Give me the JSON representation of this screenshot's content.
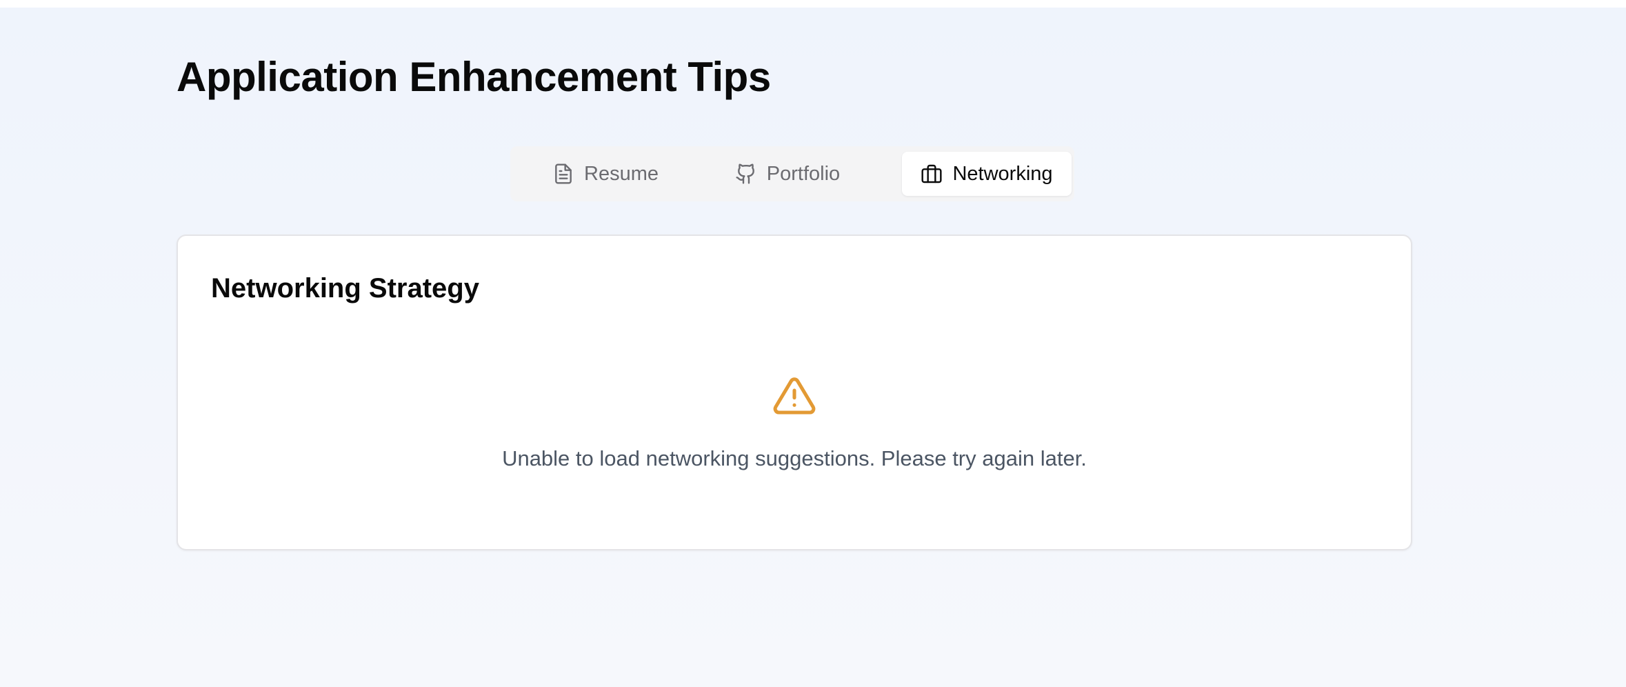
{
  "page": {
    "title": "Application Enhancement Tips"
  },
  "tabs": [
    {
      "label": "Resume",
      "icon": "file-text-icon",
      "active": false
    },
    {
      "label": "Portfolio",
      "icon": "github-icon",
      "active": false
    },
    {
      "label": "Networking",
      "icon": "briefcase-icon",
      "active": true
    }
  ],
  "card": {
    "title": "Networking Strategy",
    "error_icon": "alert-triangle-icon",
    "error_message": "Unable to load networking suggestions. Please try again later."
  },
  "colors": {
    "background": "#eff4fc",
    "warning": "#e39a34",
    "active_tab_bg": "#ffffff",
    "tab_bar_bg": "#f4f4f5",
    "muted_text": "#4b5563"
  }
}
